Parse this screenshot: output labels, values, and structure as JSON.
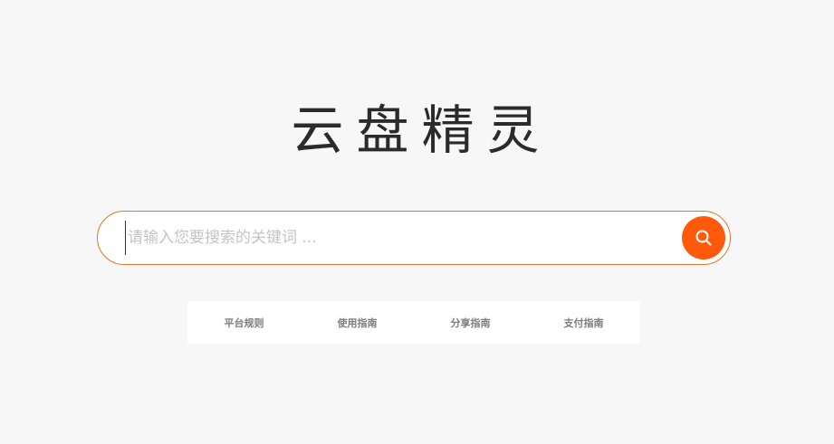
{
  "logo": {
    "text": "云盘精灵"
  },
  "search": {
    "placeholder": "请输入您要搜索的关键词 ...",
    "value": "",
    "button_icon": "search-icon"
  },
  "nav": {
    "items": [
      {
        "label": "平台规则"
      },
      {
        "label": "使用指南"
      },
      {
        "label": "分享指南"
      },
      {
        "label": "支付指南"
      }
    ]
  },
  "colors": {
    "accent": "#ff5a0b",
    "search_border": "#e0762e",
    "background": "#f7f7f8",
    "logo_text": "#2b2b2b",
    "nav_text": "#7c7c7c"
  }
}
